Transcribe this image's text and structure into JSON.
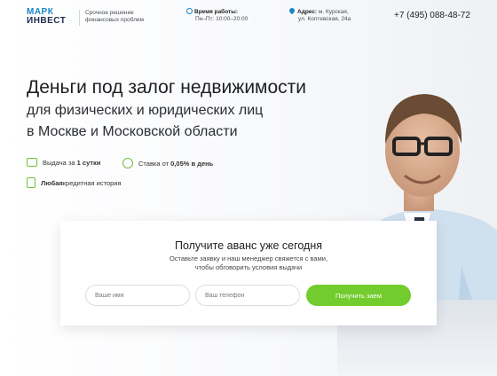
{
  "header": {
    "logo_line1": "МАРК",
    "logo_line2": "ИНВЕСТ",
    "tagline_line1": "Срочное решение",
    "tagline_line2": "финансовых проблем",
    "hours_label": "Время работы:",
    "hours_value": "Пн–Пт: 10:00–20:00",
    "address_label": "Адрес:",
    "address_line1": "м. Курская,",
    "address_line2": "ул. Коптевская, 24а",
    "phone": "+7 (495) 088-48-72"
  },
  "hero": {
    "title": "Деньги под залог недвижимости",
    "subtitle_line1": "для физических и юридических лиц",
    "subtitle_line2": "в Москве и Московской области",
    "features": [
      {
        "icon": "calendar-icon",
        "prefix": "Выдача за ",
        "bold": "1 сутки",
        "suffix": ""
      },
      {
        "icon": "percent-icon",
        "prefix": "Ставка от ",
        "bold": "0,05% в день",
        "suffix": ""
      },
      {
        "icon": "document-icon",
        "prefix": "",
        "bold": "Любая",
        "suffix": " кредитная история"
      }
    ]
  },
  "form": {
    "title": "Получите аванс уже сегодня",
    "desc_line1": "Оставьте заявку и наш менеджер свяжется с вами,",
    "desc_line2": "чтобы обговорить условия выдачи",
    "name_placeholder": "Ваше имя",
    "phone_placeholder": "Ваш телефон",
    "submit_label": "Получить заем"
  },
  "colors": {
    "accent_blue": "#1a84c7",
    "accent_green": "#72cc2d",
    "brand_dark": "#1d2b4f"
  }
}
